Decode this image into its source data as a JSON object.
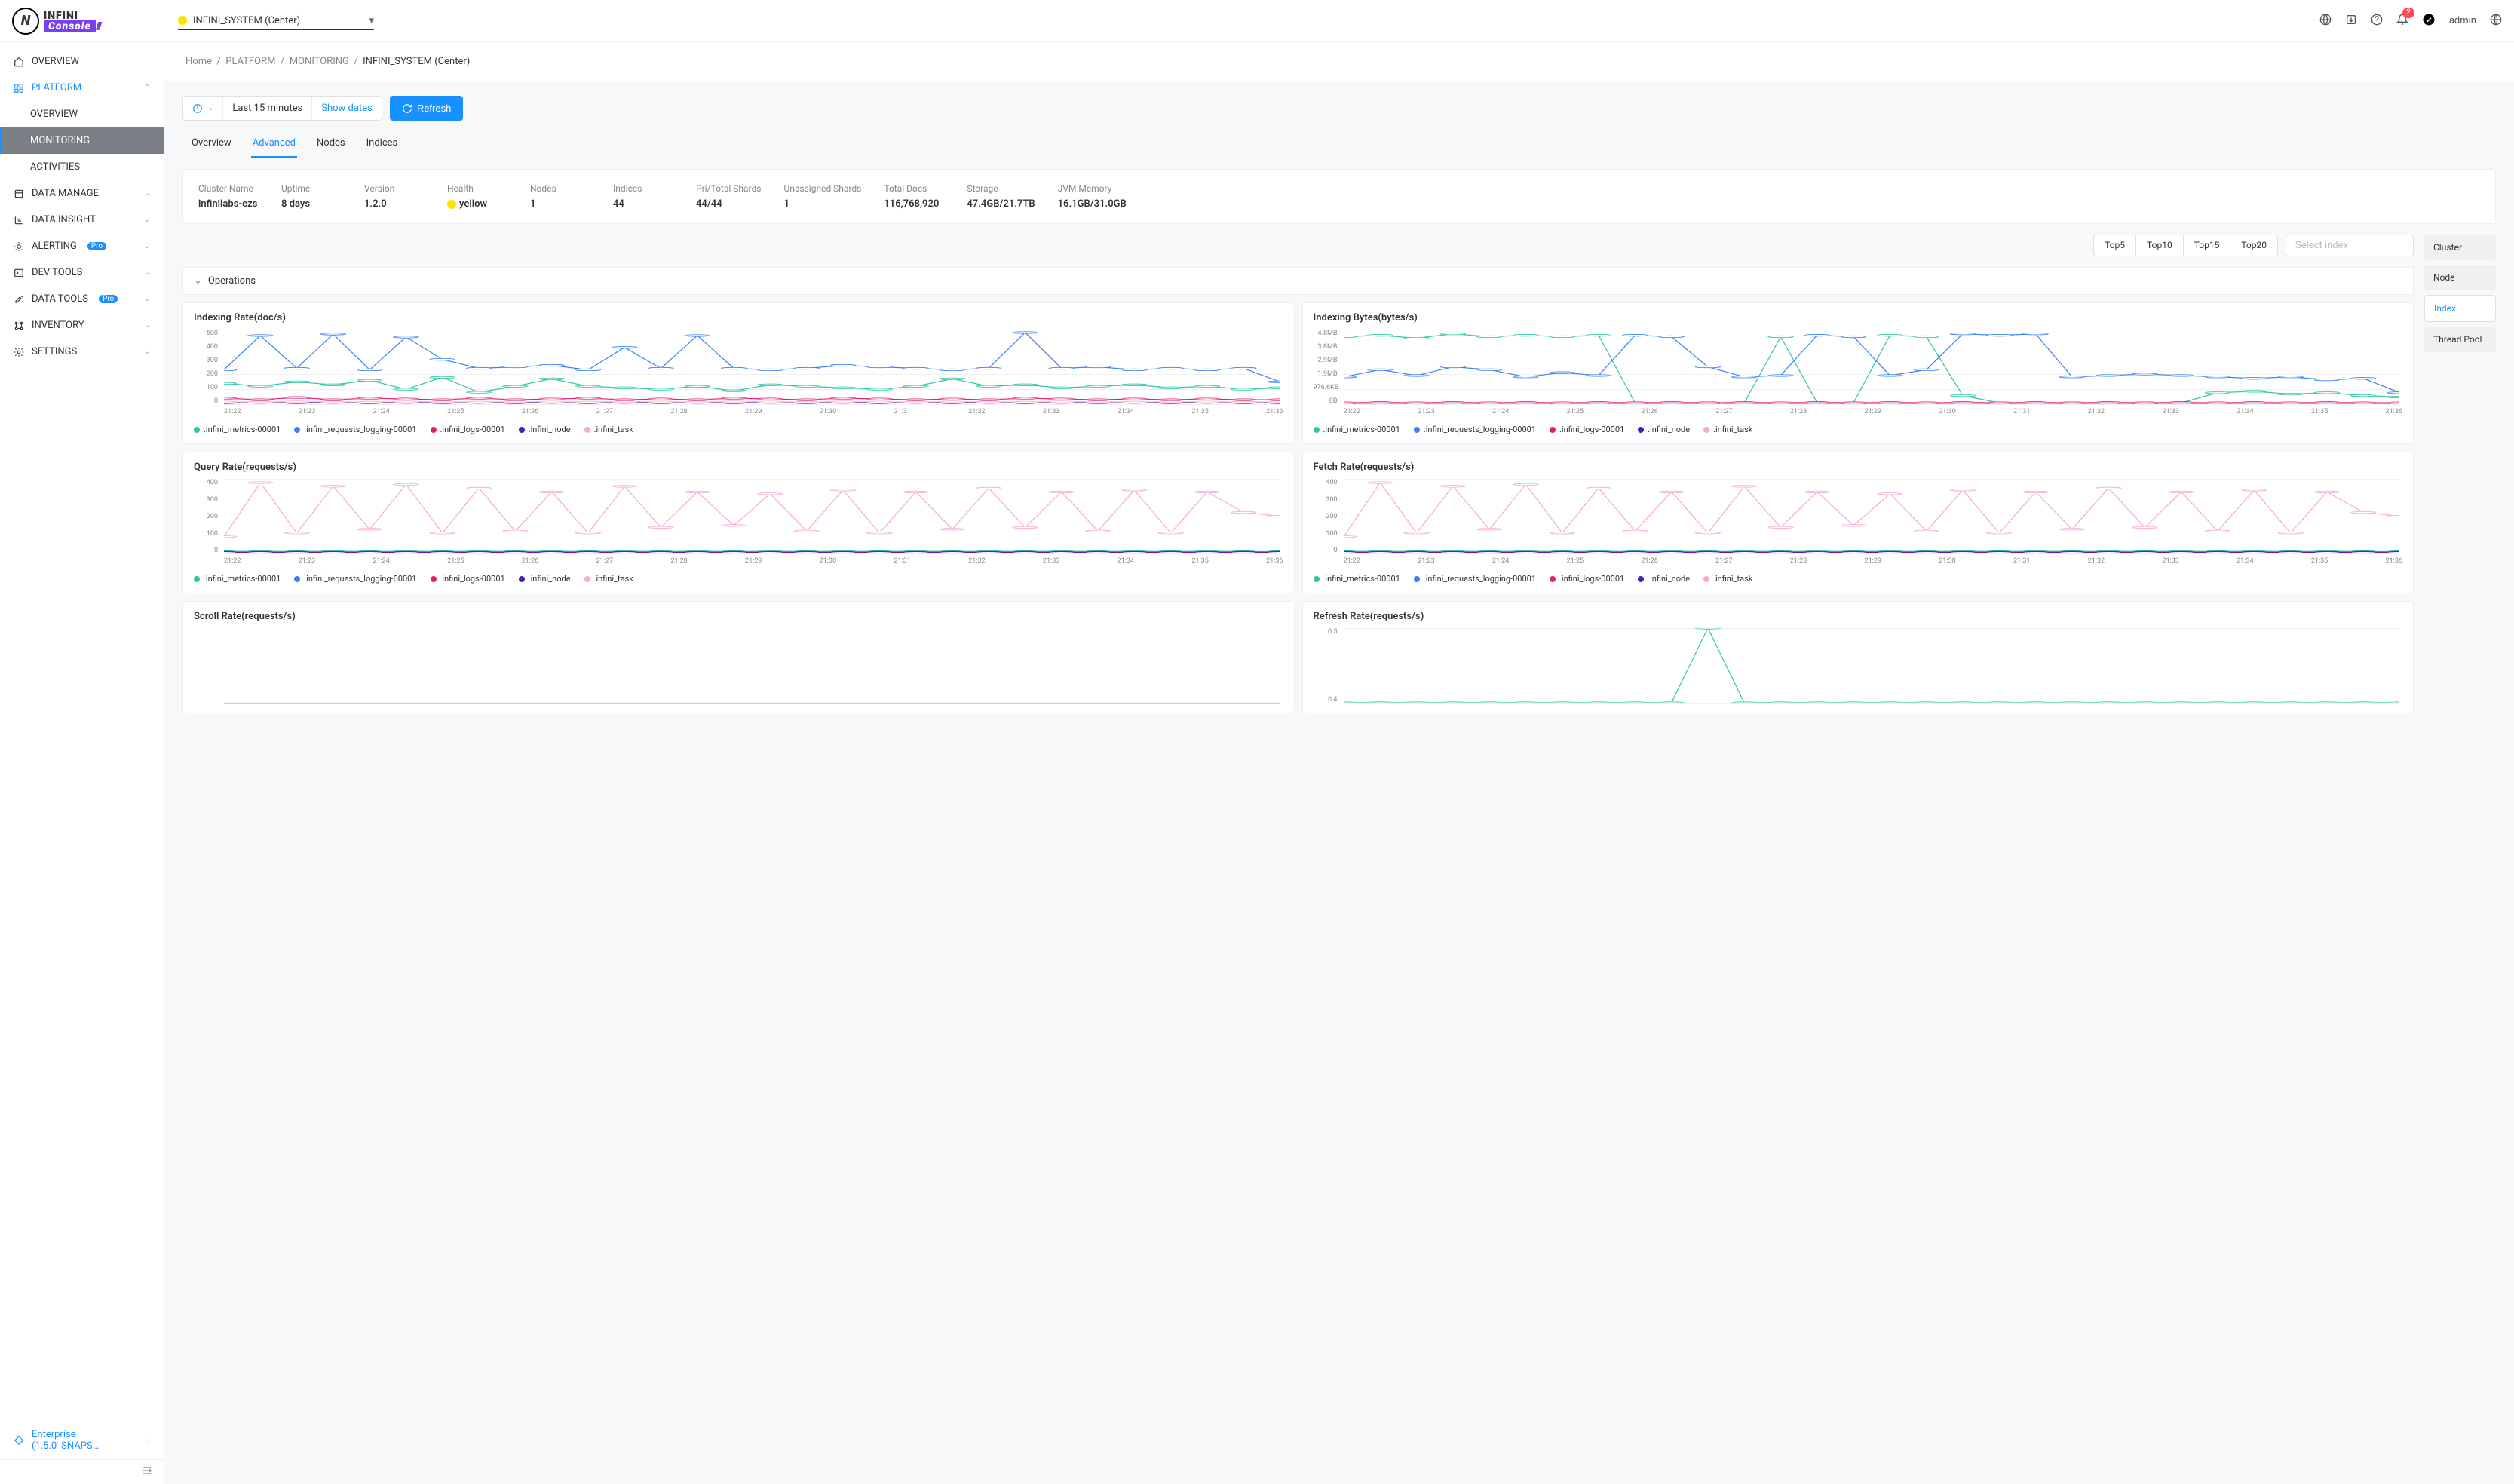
{
  "header": {
    "cluster_selected": "INFINI_SYSTEM (Center)",
    "user": "admin",
    "notif_count": "2"
  },
  "sidebar": {
    "items": [
      {
        "label": "OVERVIEW"
      },
      {
        "label": "PLATFORM"
      },
      {
        "label": "OVERVIEW"
      },
      {
        "label": "MONITORING"
      },
      {
        "label": "ACTIVITIES"
      },
      {
        "label": "DATA MANAGE"
      },
      {
        "label": "DATA INSIGHT"
      },
      {
        "label": "ALERTING",
        "pill": "Pro"
      },
      {
        "label": "DEV TOOLS"
      },
      {
        "label": "DATA TOOLS",
        "pill": "Pro"
      },
      {
        "label": "INVENTORY"
      },
      {
        "label": "SETTINGS"
      }
    ],
    "footer": "Enterprise (1.5.0_SNAPS…"
  },
  "breadcrumb": {
    "home": "Home",
    "p1": "PLATFORM",
    "p2": "MONITORING",
    "current": "INFINI_SYSTEM (Center)"
  },
  "controls": {
    "time": "Last 15 minutes",
    "show_dates": "Show dates",
    "refresh": "Refresh"
  },
  "tabs": [
    "Overview",
    "Advanced",
    "Nodes",
    "Indices"
  ],
  "stats": [
    {
      "label": "Cluster Name",
      "value": "infinilabs-ezs"
    },
    {
      "label": "Uptime",
      "value": "8 days"
    },
    {
      "label": "Version",
      "value": "1.2.0"
    },
    {
      "label": "Health",
      "value": "yellow",
      "health": true
    },
    {
      "label": "Nodes",
      "value": "1"
    },
    {
      "label": "Indices",
      "value": "44"
    },
    {
      "label": "Pri/Total Shards",
      "value": "44/44"
    },
    {
      "label": "Unassigned Shards",
      "value": "1"
    },
    {
      "label": "Total Docs",
      "value": "116,768,920"
    },
    {
      "label": "Storage",
      "value": "47.4GB/21.7TB"
    },
    {
      "label": "JVM Memory",
      "value": "16.1GB/31.0GB"
    }
  ],
  "top_buttons": [
    "Top5",
    "Top10",
    "Top15",
    "Top20"
  ],
  "select_placeholder": "Select index",
  "metric_tabs": [
    "Cluster",
    "Node",
    "Index",
    "Thread Pool"
  ],
  "section_title": "Operations",
  "legend_series": [
    {
      "name": ".infini_metrics-00001",
      "color": "#2ec7a6"
    },
    {
      "name": ".infini_requests_logging-00001",
      "color": "#3b82f6"
    },
    {
      "name": ".infini_logs-00001",
      "color": "#e11d74"
    },
    {
      "name": ".infini_node",
      "color": "#4b1fa8"
    },
    {
      "name": ".infini_task",
      "color": "#f9a8d4"
    }
  ],
  "charts": [
    {
      "title": "Indexing Rate(doc/s)"
    },
    {
      "title": "Indexing Bytes(bytes/s)"
    },
    {
      "title": "Query Rate(requests/s)"
    },
    {
      "title": "Fetch Rate(requests/s)"
    },
    {
      "title": "Scroll Rate(requests/s)"
    },
    {
      "title": "Refresh Rate(requests/s)"
    }
  ],
  "chart_data": [
    {
      "type": "line",
      "title": "Indexing Rate(doc/s)",
      "xlabel": "",
      "ylabel": "",
      "ylim": [
        0,
        500
      ],
      "y_ticks": [
        "500",
        "400",
        "300",
        "200",
        "100",
        "0"
      ],
      "x_ticks": [
        "21:22",
        "21:23",
        "21:24",
        "21:25",
        "21:26",
        "21:27",
        "21:28",
        "21:29",
        "21:30",
        "21:31",
        "21:32",
        "21:33",
        "21:34",
        "21:35",
        "21:36"
      ],
      "series": [
        {
          "name": ".infini_metrics-00001",
          "values": [
            140,
            120,
            150,
            130,
            160,
            100,
            180,
            80,
            120,
            170,
            120,
            110,
            100,
            120,
            90,
            130,
            120,
            110,
            100,
            120,
            170,
            120,
            130,
            110,
            120,
            130,
            110,
            120,
            100,
            110
          ]
        },
        {
          "name": ".infini_requests_logging-00001",
          "values": [
            230,
            460,
            240,
            470,
            230,
            450,
            300,
            240,
            250,
            260,
            230,
            380,
            240,
            460,
            240,
            230,
            240,
            260,
            250,
            240,
            230,
            240,
            480,
            240,
            250,
            230,
            240,
            230,
            240,
            150
          ]
        },
        {
          "name": ".infini_logs-00001",
          "values": [
            40,
            30,
            45,
            30,
            40,
            35,
            30,
            40,
            30,
            35,
            40,
            30,
            35,
            30,
            40,
            35,
            30,
            40,
            35,
            30,
            35,
            30,
            40,
            35,
            30,
            35,
            30,
            35,
            30,
            30
          ]
        },
        {
          "name": ".infini_node",
          "values": [
            10,
            12,
            10,
            12,
            10,
            12,
            10,
            12,
            10,
            12,
            10,
            12,
            10,
            12,
            10,
            12,
            10,
            12,
            10,
            12,
            10,
            12,
            10,
            12,
            10,
            12,
            10,
            12,
            10,
            10
          ]
        },
        {
          "name": ".infini_task",
          "values": [
            15,
            14,
            16,
            15,
            14,
            16,
            15,
            14,
            16,
            15,
            14,
            16,
            15,
            14,
            16,
            15,
            14,
            16,
            15,
            14,
            16,
            15,
            14,
            16,
            15,
            14,
            16,
            15,
            14,
            15
          ]
        }
      ]
    },
    {
      "type": "line",
      "title": "Indexing Bytes(bytes/s)",
      "xlabel": "",
      "ylabel": "",
      "ylim": [
        0,
        5200000
      ],
      "y_ticks": [
        "4.8MB",
        "3.8MB",
        "2.9MB",
        "1.9MB",
        "976.6KB",
        "0B"
      ],
      "x_ticks": [
        "21:22",
        "21:23",
        "21:24",
        "21:25",
        "21:26",
        "21:27",
        "21:28",
        "21:29",
        "21:30",
        "21:31",
        "21:32",
        "21:33",
        "21:34",
        "21:35",
        "21:36"
      ],
      "series": [
        {
          "name": ".infini_metrics-00001",
          "values": [
            4700000,
            4800000,
            4600000,
            4900000,
            4700000,
            4800000,
            4700000,
            4800000,
            100000,
            100000,
            100000,
            100000,
            4700000,
            100000,
            100000,
            4800000,
            4700000,
            600000,
            100000,
            100000,
            100000,
            100000,
            100000,
            100000,
            800000,
            900000,
            700000,
            800000,
            600000,
            500000
          ]
        },
        {
          "name": ".infini_requests_logging-00001",
          "values": [
            1900000,
            2400000,
            2000000,
            2600000,
            2400000,
            1900000,
            2200000,
            2000000,
            4800000,
            4700000,
            2600000,
            1900000,
            2000000,
            4800000,
            4700000,
            2000000,
            2400000,
            4900000,
            4800000,
            4900000,
            1900000,
            2000000,
            2100000,
            2000000,
            1900000,
            1800000,
            1900000,
            1700000,
            1800000,
            800000
          ]
        },
        {
          "name": ".infini_logs-00001",
          "values": [
            100000,
            120000,
            100000,
            120000,
            100000,
            120000,
            100000,
            120000,
            100000,
            120000,
            100000,
            120000,
            100000,
            120000,
            100000,
            120000,
            100000,
            120000,
            100000,
            120000,
            100000,
            120000,
            100000,
            120000,
            100000,
            120000,
            100000,
            120000,
            100000,
            100000
          ]
        },
        {
          "name": ".infini_node",
          "values": [
            50000,
            60000,
            50000,
            60000,
            50000,
            60000,
            50000,
            60000,
            50000,
            60000,
            50000,
            60000,
            50000,
            60000,
            50000,
            60000,
            50000,
            60000,
            50000,
            60000,
            50000,
            60000,
            50000,
            60000,
            50000,
            60000,
            50000,
            60000,
            50000,
            50000
          ]
        },
        {
          "name": ".infini_task",
          "values": [
            70000,
            70000,
            70000,
            70000,
            70000,
            70000,
            70000,
            70000,
            70000,
            70000,
            70000,
            70000,
            70000,
            70000,
            70000,
            70000,
            70000,
            70000,
            70000,
            70000,
            70000,
            70000,
            70000,
            70000,
            70000,
            70000,
            70000,
            70000,
            70000,
            70000
          ]
        }
      ]
    },
    {
      "type": "line",
      "title": "Query Rate(requests/s)",
      "xlabel": "",
      "ylabel": "",
      "ylim": [
        0,
        400
      ],
      "y_ticks": [
        "400",
        "300",
        "200",
        "100",
        "0"
      ],
      "x_ticks": [
        "21:22",
        "21:23",
        "21:24",
        "21:25",
        "21:26",
        "21:27",
        "21:28",
        "21:29",
        "21:30",
        "21:31",
        "21:32",
        "21:33",
        "21:34",
        "21:35",
        "21:36"
      ],
      "series": [
        {
          "name": ".infini_metrics-00001",
          "values": [
            10,
            12,
            10,
            12,
            10,
            12,
            10,
            12,
            10,
            12,
            10,
            12,
            10,
            12,
            10,
            12,
            10,
            12,
            10,
            12,
            10,
            12,
            10,
            12,
            10,
            12,
            10,
            12,
            10,
            10
          ]
        },
        {
          "name": ".infini_requests_logging-00001",
          "values": [
            8,
            8,
            8,
            8,
            8,
            8,
            8,
            8,
            8,
            8,
            8,
            8,
            8,
            8,
            8,
            8,
            8,
            8,
            8,
            8,
            8,
            8,
            8,
            8,
            8,
            8,
            8,
            8,
            8,
            8
          ]
        },
        {
          "name": ".infini_logs-00001",
          "values": [
            6,
            6,
            6,
            6,
            6,
            6,
            6,
            6,
            6,
            6,
            6,
            6,
            6,
            6,
            6,
            6,
            6,
            6,
            6,
            6,
            6,
            6,
            6,
            6,
            6,
            6,
            6,
            6,
            6,
            6
          ]
        },
        {
          "name": ".infini_node",
          "values": [
            5,
            5,
            5,
            5,
            5,
            5,
            5,
            5,
            5,
            5,
            5,
            5,
            5,
            5,
            5,
            5,
            5,
            5,
            5,
            5,
            5,
            5,
            5,
            5,
            5,
            5,
            5,
            5,
            5,
            5
          ]
        },
        {
          "name": ".infini_task",
          "values": [
            90,
            380,
            110,
            360,
            130,
            370,
            110,
            350,
            120,
            330,
            110,
            360,
            140,
            330,
            150,
            320,
            120,
            340,
            110,
            330,
            130,
            350,
            140,
            330,
            120,
            340,
            110,
            330,
            220,
            200
          ]
        }
      ]
    },
    {
      "type": "line",
      "title": "Fetch Rate(requests/s)",
      "xlabel": "",
      "ylabel": "",
      "ylim": [
        0,
        400
      ],
      "y_ticks": [
        "400",
        "300",
        "200",
        "100",
        "0"
      ],
      "x_ticks": [
        "21:22",
        "21:23",
        "21:24",
        "21:25",
        "21:26",
        "21:27",
        "21:28",
        "21:29",
        "21:30",
        "21:31",
        "21:32",
        "21:33",
        "21:34",
        "21:35",
        "21:36"
      ],
      "series": [
        {
          "name": ".infini_metrics-00001",
          "values": [
            10,
            12,
            10,
            12,
            10,
            12,
            10,
            12,
            10,
            12,
            10,
            12,
            10,
            12,
            10,
            12,
            10,
            12,
            10,
            12,
            10,
            12,
            10,
            12,
            10,
            12,
            10,
            12,
            10,
            10
          ]
        },
        {
          "name": ".infini_requests_logging-00001",
          "values": [
            8,
            8,
            8,
            8,
            8,
            8,
            8,
            8,
            8,
            8,
            8,
            8,
            8,
            8,
            8,
            8,
            8,
            8,
            8,
            8,
            8,
            8,
            8,
            8,
            8,
            8,
            8,
            8,
            8,
            8
          ]
        },
        {
          "name": ".infini_logs-00001",
          "values": [
            6,
            6,
            6,
            6,
            6,
            6,
            6,
            6,
            6,
            6,
            6,
            6,
            6,
            6,
            6,
            6,
            6,
            6,
            6,
            6,
            6,
            6,
            6,
            6,
            6,
            6,
            6,
            6,
            6,
            6
          ]
        },
        {
          "name": ".infini_node",
          "values": [
            5,
            5,
            5,
            5,
            5,
            5,
            5,
            5,
            5,
            5,
            5,
            5,
            5,
            5,
            5,
            5,
            5,
            5,
            5,
            5,
            5,
            5,
            5,
            5,
            5,
            5,
            5,
            5,
            5,
            5
          ]
        },
        {
          "name": ".infini_task",
          "values": [
            90,
            380,
            110,
            360,
            130,
            370,
            110,
            350,
            120,
            330,
            110,
            360,
            140,
            330,
            150,
            320,
            120,
            340,
            110,
            330,
            130,
            350,
            140,
            330,
            120,
            340,
            110,
            330,
            220,
            200
          ]
        }
      ]
    },
    {
      "type": "line",
      "title": "Scroll Rate(requests/s)",
      "xlabel": "",
      "ylabel": "",
      "ylim": [
        0,
        1
      ],
      "y_ticks": [],
      "x_ticks": [],
      "series": []
    },
    {
      "type": "line",
      "title": "Refresh Rate(requests/s)",
      "xlabel": "",
      "ylabel": "",
      "ylim": [
        0,
        0.5
      ],
      "y_ticks": [
        "0.5",
        "0.4"
      ],
      "x_ticks": [],
      "series": [
        {
          "name": ".infini_metrics-00001",
          "values": [
            0,
            0,
            0,
            0,
            0,
            0,
            0,
            0,
            0,
            0,
            0.5,
            0,
            0,
            0,
            0,
            0,
            0,
            0,
            0,
            0,
            0,
            0,
            0,
            0,
            0,
            0,
            0,
            0,
            0,
            0
          ]
        }
      ]
    }
  ]
}
